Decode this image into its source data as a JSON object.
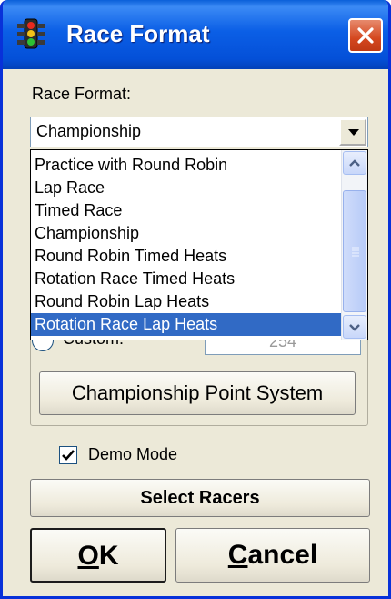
{
  "window": {
    "title": "Race Format",
    "icon": "traffic-light-icon",
    "title_bar_color": "#0450d8",
    "close_button_color": "#d4471f"
  },
  "race_format": {
    "label": "Race Format:",
    "selected_value": "Championship",
    "options": [
      "Practice with Round Robin",
      "Lap Race",
      "Timed Race",
      "Championship",
      "Round Robin Timed Heats",
      "Rotation Race Timed Heats",
      "Round Robin Lap Heats",
      "Rotation Race Lap Heats"
    ],
    "highlighted_option": "Rotation Race Lap Heats",
    "highlight_color": "#316ac5"
  },
  "custom": {
    "label": "Custom:",
    "value": "254"
  },
  "buttons": {
    "championship_points": "Championship Point System",
    "select_racers": "Select Racers",
    "ok_mnemonic": "O",
    "ok_rest": "K",
    "cancel_mnemonic": "C",
    "cancel_rest": "ancel"
  },
  "demo_mode": {
    "label": "Demo Mode",
    "checked": true
  }
}
